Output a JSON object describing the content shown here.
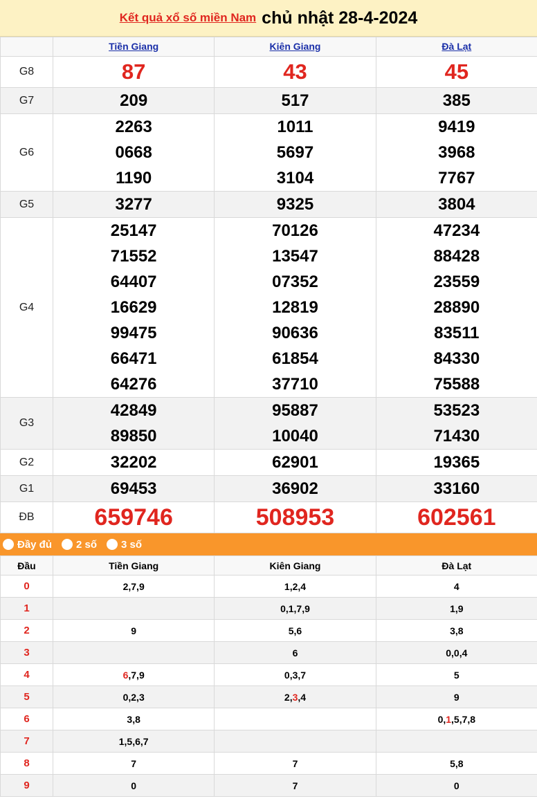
{
  "header": {
    "link_text": "Kết quả xổ số miền Nam",
    "date_text": "chủ nhật 28-4-2024"
  },
  "provinces": [
    "Tiền Giang",
    "Kiên Giang",
    "Đà Lạt"
  ],
  "prizes": [
    {
      "label": "G8",
      "values": [
        [
          "87"
        ],
        [
          "43"
        ],
        [
          "45"
        ]
      ]
    },
    {
      "label": "G7",
      "values": [
        [
          "209"
        ],
        [
          "517"
        ],
        [
          "385"
        ]
      ]
    },
    {
      "label": "G6",
      "values": [
        [
          "2263",
          "0668",
          "1190"
        ],
        [
          "1011",
          "5697",
          "3104"
        ],
        [
          "9419",
          "3968",
          "7767"
        ]
      ]
    },
    {
      "label": "G5",
      "values": [
        [
          "3277"
        ],
        [
          "9325"
        ],
        [
          "3804"
        ]
      ]
    },
    {
      "label": "G4",
      "values": [
        [
          "25147",
          "71552",
          "64407",
          "16629",
          "99475",
          "66471",
          "64276"
        ],
        [
          "70126",
          "13547",
          "07352",
          "12819",
          "90636",
          "61854",
          "37710"
        ],
        [
          "47234",
          "88428",
          "23559",
          "28890",
          "83511",
          "84330",
          "75588"
        ]
      ]
    },
    {
      "label": "G3",
      "values": [
        [
          "42849",
          "89850"
        ],
        [
          "95887",
          "10040"
        ],
        [
          "53523",
          "71430"
        ]
      ]
    },
    {
      "label": "G2",
      "values": [
        [
          "32202"
        ],
        [
          "62901"
        ],
        [
          "19365"
        ]
      ]
    },
    {
      "label": "G1",
      "values": [
        [
          "69453"
        ],
        [
          "36902"
        ],
        [
          "33160"
        ]
      ]
    },
    {
      "label": "ĐB",
      "values": [
        [
          "659746"
        ],
        [
          "508953"
        ],
        [
          "602561"
        ]
      ]
    }
  ],
  "filter": {
    "options": [
      "Đầy đủ",
      "2 số",
      "3 số"
    ]
  },
  "loto": {
    "head_label": "Đầu",
    "rows": [
      {
        "dau": "0",
        "cells": [
          [
            [
              "2,7,9",
              false
            ]
          ],
          [
            [
              "1,2,4",
              false
            ]
          ],
          [
            [
              "4",
              false
            ]
          ]
        ]
      },
      {
        "dau": "1",
        "cells": [
          [],
          [
            [
              "0,1,7,9",
              false
            ]
          ],
          [
            [
              "1,9",
              false
            ]
          ]
        ]
      },
      {
        "dau": "2",
        "cells": [
          [
            [
              "9",
              false
            ]
          ],
          [
            [
              "5,6",
              false
            ]
          ],
          [
            [
              "3,8",
              false
            ]
          ]
        ]
      },
      {
        "dau": "3",
        "cells": [
          [],
          [
            [
              "6",
              false
            ]
          ],
          [
            [
              "0,0,4",
              false
            ]
          ]
        ]
      },
      {
        "dau": "4",
        "cells": [
          [
            [
              "6",
              true
            ],
            [
              ",7,9",
              false
            ]
          ],
          [
            [
              "0,3,7",
              false
            ]
          ],
          [
            [
              "5",
              false
            ]
          ]
        ]
      },
      {
        "dau": "5",
        "cells": [
          [
            [
              "0,2,3",
              false
            ]
          ],
          [
            [
              "2,",
              false
            ],
            [
              "3",
              true
            ],
            [
              ",4",
              false
            ]
          ],
          [
            [
              "9",
              false
            ]
          ]
        ]
      },
      {
        "dau": "6",
        "cells": [
          [
            [
              "3,8",
              false
            ]
          ],
          [],
          [
            [
              "0,",
              false
            ],
            [
              "1",
              true
            ],
            [
              ",5,7,8",
              false
            ]
          ]
        ]
      },
      {
        "dau": "7",
        "cells": [
          [
            [
              "1,5,6,7",
              false
            ]
          ],
          [],
          []
        ]
      },
      {
        "dau": "8",
        "cells": [
          [
            [
              "7",
              false
            ]
          ],
          [
            [
              "7",
              false
            ]
          ],
          [
            [
              "5,8",
              false
            ]
          ]
        ]
      },
      {
        "dau": "9",
        "cells": [
          [
            [
              "0",
              false
            ]
          ],
          [
            [
              "7",
              false
            ]
          ],
          [
            [
              "0",
              false
            ]
          ]
        ]
      }
    ]
  },
  "colors": {
    "accent_red": "#e0261f",
    "header_bg": "#fdf2c4",
    "filter_bg": "#f9962b",
    "province_blue": "#1a2fa8"
  }
}
